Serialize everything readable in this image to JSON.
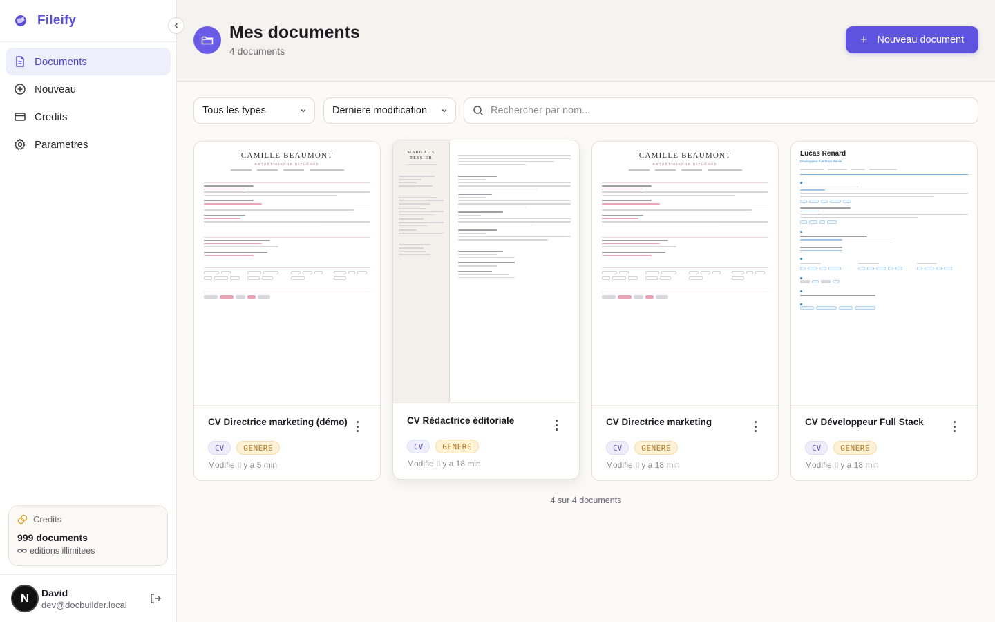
{
  "app": {
    "name": "Fileify"
  },
  "sidebar": {
    "items": [
      {
        "label": "Documents",
        "icon": "file-text-icon",
        "active": true
      },
      {
        "label": "Nouveau",
        "icon": "plus-circle-icon",
        "active": false
      },
      {
        "label": "Credits",
        "icon": "credit-card-icon",
        "active": false
      },
      {
        "label": "Parametres",
        "icon": "gear-icon",
        "active": false
      }
    ],
    "credits": {
      "title": "Credits",
      "count": "999 documents",
      "subtitle": "editions illimitees"
    },
    "user": {
      "initial": "N",
      "name": "David",
      "email": "dev@docbuilder.local"
    }
  },
  "header": {
    "title": "Mes documents",
    "count": "4 documents",
    "new_button": "Nouveau document"
  },
  "filters": {
    "type_select": "Tous les types",
    "sort_select": "Derniere modification",
    "search_placeholder": "Rechercher par nom..."
  },
  "documents": [
    {
      "title": "CV Directrice marketing (démo)",
      "badges": [
        "CV",
        "GENERE"
      ],
      "modified": "Modifie Il y a 5 min",
      "preview": {
        "template": "classic",
        "name": "CAMILLE BEAUMONT",
        "role": "ESTHÉTICIENNE DIPLÔMÉE"
      }
    },
    {
      "title": "CV Rédactrice éditoriale",
      "badges": [
        "CV",
        "GENERE"
      ],
      "modified": "Modifie Il y a 18 min",
      "preview": {
        "template": "sidebar",
        "name": "MARGAUX TESSIER"
      }
    },
    {
      "title": "CV Directrice marketing",
      "badges": [
        "CV",
        "GENERE"
      ],
      "modified": "Modifie Il y a 18 min",
      "preview": {
        "template": "classic",
        "name": "CAMILLE BEAUMONT",
        "role": "ESTHÉTICIENNE DIPLÔMÉE"
      }
    },
    {
      "title": "CV Développeur Full Stack",
      "badges": [
        "CV",
        "GENERE"
      ],
      "modified": "Modifie Il y a 18 min",
      "preview": {
        "template": "modern",
        "name": "Lucas Renard",
        "role": "Développeur Full Stack Senior"
      }
    }
  ],
  "footer": {
    "count": "4 sur 4 documents"
  },
  "colors": {
    "accent": "#5e52e0",
    "brand": "#5b4fd6",
    "badge_cv_bg": "#eeeefb",
    "badge_genere_bg": "#fdf1d6",
    "badge_genere_text": "#b7791f"
  }
}
